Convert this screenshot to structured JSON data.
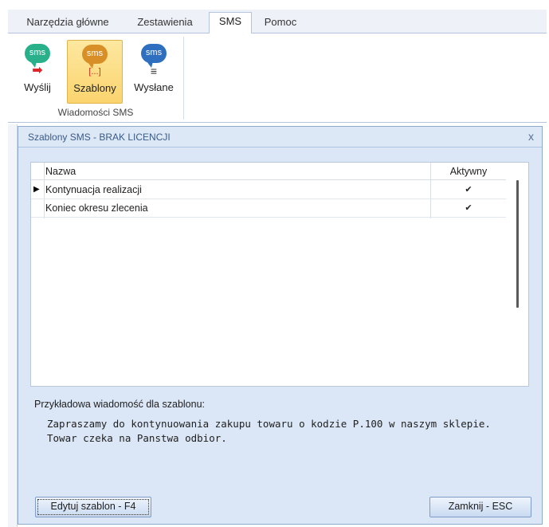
{
  "ribbon": {
    "tabs": [
      {
        "label": "Narzędzia główne",
        "active": false
      },
      {
        "label": "Zestawienia",
        "active": false
      },
      {
        "label": "SMS",
        "active": true
      },
      {
        "label": "Pomoc",
        "active": false
      }
    ],
    "buttons": [
      {
        "icon_text": "sms",
        "sub_icon": "➡",
        "label": "Wyślij",
        "icon": "sms-send-icon",
        "selected": false
      },
      {
        "icon_text": "sms",
        "sub_icon": "[...]",
        "label": "Szablony",
        "icon": "sms-templates-icon",
        "selected": true
      },
      {
        "icon_text": "sms",
        "sub_icon": "≡",
        "label": "Wysłane",
        "icon": "sms-sent-icon",
        "selected": false
      }
    ],
    "group_label": "Wiadomości SMS"
  },
  "window": {
    "title": "Szablony SMS -  BRAK LICENCJI",
    "close_glyph": "x"
  },
  "grid": {
    "columns": [
      "Nazwa",
      "Aktywny"
    ],
    "rows": [
      {
        "name": "Kontynuacja realizacji",
        "active": "✔",
        "current": true
      },
      {
        "name": "Koniec okresu zlecenia",
        "active": "✔",
        "current": false
      }
    ]
  },
  "preview": {
    "label": "Przykładowa wiadomość dla szablonu:",
    "line1": "Zapraszamy do kontynuowania zakupu towaru o kodzie P.100 w naszym sklepie.",
    "line2": "Towar czeka na Panstwa odbior."
  },
  "buttons": {
    "edit": "Edytuj szablon - F4",
    "close": "Zamknij - ESC"
  },
  "colors": {
    "window_bg": "#dbe7f6",
    "selected_button": "#fbd46e",
    "sms_green": "#27b08a",
    "sms_orange": "#d98f27",
    "sms_blue": "#2e6fbf"
  }
}
